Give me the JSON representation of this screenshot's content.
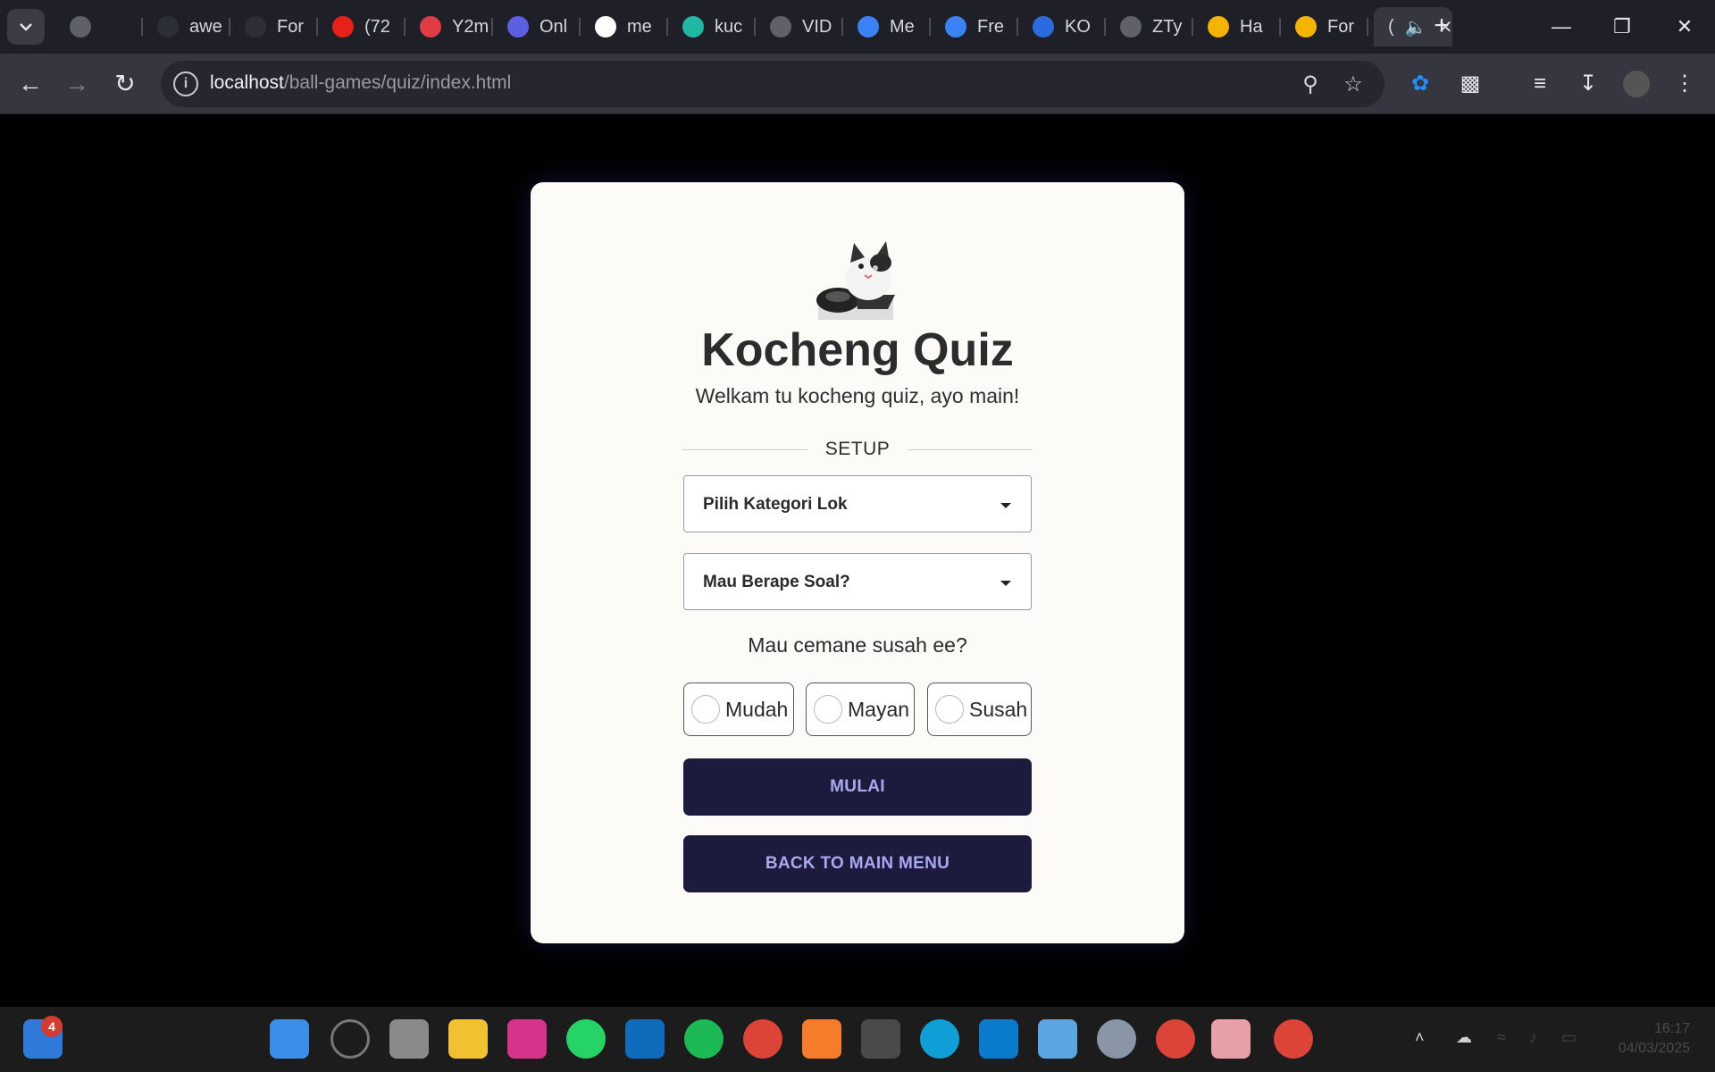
{
  "browser": {
    "tabs": [
      {
        "label": "",
        "icon": "globe-icon",
        "color": "#5f6168"
      },
      {
        "label": "awe",
        "icon": "github-icon",
        "color": "#2d2f36"
      },
      {
        "label": "For",
        "icon": "openai-icon",
        "color": "#2d2f36"
      },
      {
        "label": "(72",
        "icon": "youtube-icon",
        "color": "#e62117"
      },
      {
        "label": "Y2m",
        "icon": "download-icon",
        "color": "#e03c45"
      },
      {
        "label": "Onl",
        "icon": "convert-icon",
        "color": "#5b5fe0"
      },
      {
        "label": "me",
        "icon": "google-icon",
        "color": "#ffffff"
      },
      {
        "label": "kuc",
        "icon": "wave-icon",
        "color": "#1fb8a5"
      },
      {
        "label": "VID",
        "icon": "globe-icon",
        "color": "#5f6168"
      },
      {
        "label": "Me",
        "icon": "webflow-icon",
        "color": "#3b82f6"
      },
      {
        "label": "Fre",
        "icon": "webflow-icon",
        "color": "#3b82f6"
      },
      {
        "label": "KO",
        "icon": "canva-icon",
        "color": "#2a6cdf"
      },
      {
        "label": "ZTy",
        "icon": "globe-icon",
        "color": "#5f6168"
      },
      {
        "label": "Ha",
        "icon": "layers-icon",
        "color": "#f4b400"
      },
      {
        "label": "For",
        "icon": "gform-icon",
        "color": "#f4b400"
      }
    ],
    "active_tab": {
      "label": "(",
      "icon": "speaker-icon"
    },
    "new_tab": "+",
    "url_host": "localhost",
    "url_path": "/ball-games/quiz/index.html"
  },
  "quiz": {
    "title": "Kocheng Quiz",
    "subtitle": "Welkam tu kocheng quiz, ayo main!",
    "setup_label": "SETUP",
    "category_select": "Pilih Kategori Lok",
    "count_select": "Mau Berape Soal?",
    "difficulty_question": "Mau cemane susah ee?",
    "difficulties": [
      "Mudah",
      "Mayan",
      "Susah"
    ],
    "start_button": "MULAI",
    "back_button": "BACK TO MAIN MENU"
  },
  "taskbar": {
    "badge_count": "4",
    "time": "16:17",
    "date": "04/03/2025"
  }
}
